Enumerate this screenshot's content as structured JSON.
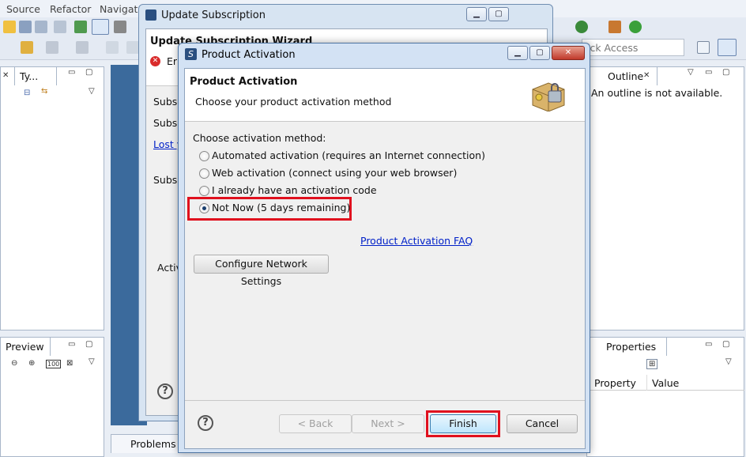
{
  "menu": {
    "source": "Source",
    "refactor": "Refactor",
    "navigate": "Navigate"
  },
  "quick_access": {
    "label": "ick Access"
  },
  "left_panel": {
    "tab": "Ty..."
  },
  "outline": {
    "tab": "Outline",
    "empty_msg": "An outline is not available."
  },
  "preview": {
    "tab": "Preview",
    "zoom": "100"
  },
  "properties": {
    "tab": "Properties",
    "col_property": "Property",
    "col_value": "Value"
  },
  "problems": {
    "tab": "Problems"
  },
  "update_subscription": {
    "title": "Update Subscription",
    "wizard_title": "Update Subscription Wizard",
    "error_prefix": "Err",
    "labels": [
      "Subsc",
      "Subsc",
      "Lost y",
      "Subsc",
      "Activ"
    ]
  },
  "product_activation": {
    "title": "Product Activation",
    "heading": "Product Activation",
    "subheading": "Choose your product activation method",
    "choose_label": "Choose activation method:",
    "options": [
      {
        "label": "Automated activation (requires an Internet connection)",
        "selected": false
      },
      {
        "label": "Web activation (connect using your web browser)",
        "selected": false
      },
      {
        "label": "I already have an activation code",
        "selected": false
      },
      {
        "label": "Not Now (5 days remaining)",
        "selected": true
      }
    ],
    "faq_link": "Product Activation FAQ",
    "configure_button": "Configure Network Settings",
    "back_button": "< Back",
    "next_button": "Next >",
    "finish_button": "Finish",
    "cancel_button": "Cancel",
    "help_symbol": "?"
  },
  "colors": {
    "highlight": "#e0101e",
    "link": "#0020c8",
    "title_bar": "#d3e2f4"
  }
}
